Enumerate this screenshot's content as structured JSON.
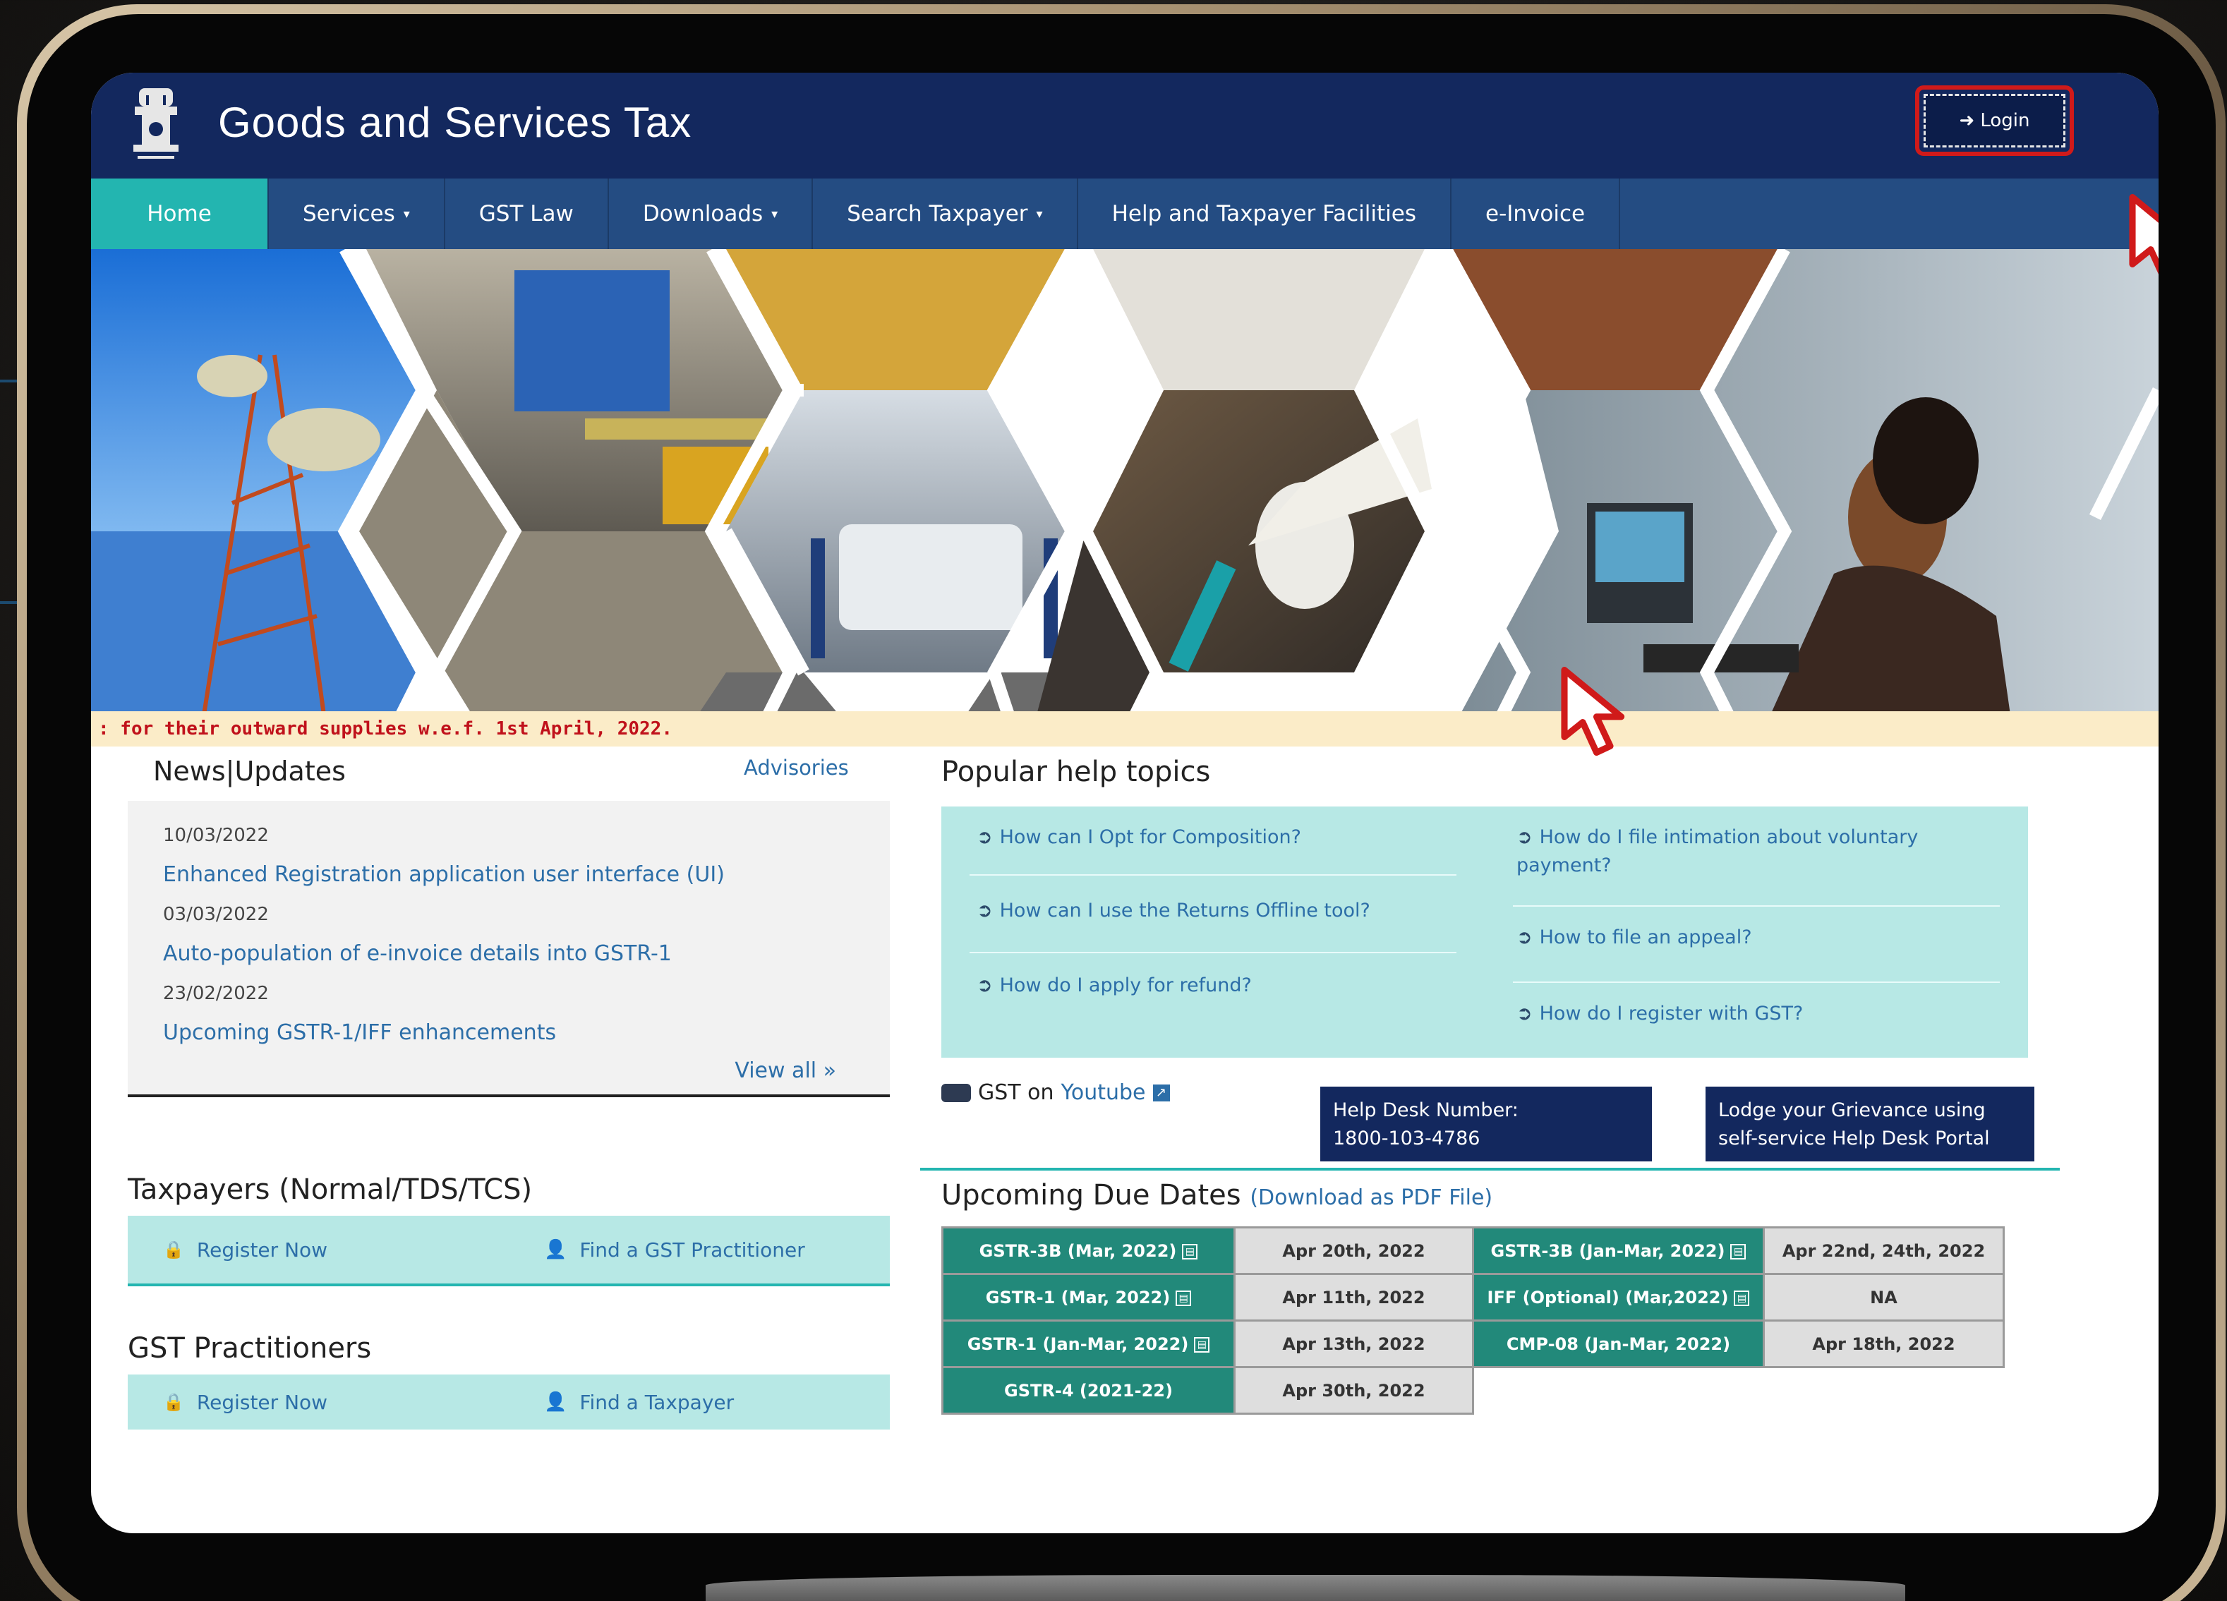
{
  "header": {
    "site_title": "Goods and Services Tax",
    "login_label": "Login",
    "login_icon": "sign-in-icon"
  },
  "nav": {
    "items": [
      {
        "label": "Home",
        "has_dropdown": false
      },
      {
        "label": "Services",
        "has_dropdown": true
      },
      {
        "label": "GST Law",
        "has_dropdown": false
      },
      {
        "label": "Downloads",
        "has_dropdown": true
      },
      {
        "label": "Search Taxpayer",
        "has_dropdown": true
      },
      {
        "label": "Help and Taxpayer Facilities",
        "has_dropdown": false
      },
      {
        "label": "e-Invoice",
        "has_dropdown": false
      }
    ],
    "caret": "▾"
  },
  "ticker": {
    "text": ": for their outward supplies w.e.f. 1st April, 2022."
  },
  "news": {
    "title": "News|Updates",
    "advisories": "Advisories",
    "items": [
      {
        "date": "10/03/2022",
        "text": "Enhanced Registration application user interface (UI)"
      },
      {
        "date": "03/03/2022",
        "text": "Auto-population of e-invoice details into GSTR-1"
      },
      {
        "date": "23/02/2022",
        "text": "Upcoming GSTR-1/IFF enhancements"
      }
    ],
    "view_all": "View all »"
  },
  "taxpayers": {
    "title": "Taxpayers (Normal/TDS/TCS)",
    "register": "Register Now",
    "find": "Find a GST Practitioner"
  },
  "practitioners": {
    "title": "GST Practitioners",
    "register": "Register Now",
    "find": "Find a Taxpayer"
  },
  "popular": {
    "title": "Popular help topics",
    "left": [
      "How can I Opt for Composition?",
      "How can I use the Returns Offline tool?",
      "How do I apply for refund?"
    ],
    "right": [
      "How do I file intimation about voluntary payment?",
      "How to file an appeal?",
      "How do I register with GST?"
    ]
  },
  "youtube": {
    "prefix": "GST on",
    "link": "Youtube"
  },
  "helpdesk": {
    "label": "Help Desk Number:",
    "number": "1800-103-4786"
  },
  "grievance": {
    "line1": "Lodge your Grievance using",
    "line2": "self-service Help Desk Portal"
  },
  "due_dates": {
    "title": "Upcoming Due Dates",
    "download": "(Download as PDF File)",
    "left": [
      {
        "form": "GSTR-3B (Mar, 2022)",
        "date": "Apr 20th, 2022"
      },
      {
        "form": "GSTR-1 (Mar, 2022)",
        "date": "Apr 11th, 2022"
      },
      {
        "form": "GSTR-1 (Jan-Mar, 2022)",
        "date": "Apr 13th, 2022"
      },
      {
        "form": "GSTR-4 (2021-22)",
        "date": "Apr 30th, 2022"
      }
    ],
    "right": [
      {
        "form": "GSTR-3B (Jan-Mar, 2022)",
        "date": "Apr 22nd, 24th, 2022"
      },
      {
        "form": "IFF (Optional) (Mar,2022)",
        "date": "NA"
      },
      {
        "form": "CMP-08 (Jan-Mar, 2022)",
        "date": "Apr 18th, 2022"
      }
    ]
  },
  "colors": {
    "header_bg": "#13285e",
    "nav_bg": "#244c82",
    "nav_active": "#23b5b0",
    "link": "#2c6ea8",
    "panel_bg": "#b7e8e5",
    "ticker_text": "#c0111b",
    "due_form_bg": "#22897a",
    "highlight": "#d01a1a"
  }
}
